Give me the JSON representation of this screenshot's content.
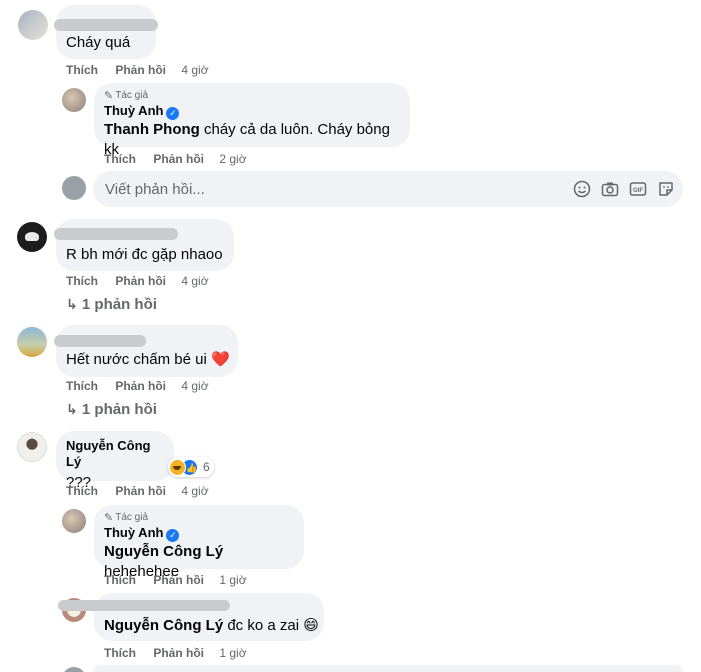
{
  "labels": {
    "like": "Thích",
    "reply": "Phản hồi",
    "author": "Tác giả"
  },
  "comments": [
    {
      "text": "Cháy quá",
      "time": "4 giờ"
    },
    {
      "text": "R bh mới đc gặp nhaoo",
      "replies_link": "1 phản hồi"
    },
    {
      "text": "Hết nước chấm bé ui ❤️",
      "time": "4 giờ",
      "replies_link": "1 phản hồi"
    },
    {
      "name": "Nguyễn Công Lý",
      "text": "???",
      "time": "4 giờ",
      "reaction_count": "6"
    },
    {
      "text": "đc ko a zai 😄",
      "mention": "Nguyễn Công Lý",
      "time": "1 giờ"
    }
  ],
  "replies": [
    {
      "name": "Thuỳ Anh",
      "mention": "Thanh Phong",
      "text": "cháy cả da luôn. Cháy bỏng kk",
      "time": "2 giờ"
    },
    {
      "name": "Thuỳ Anh",
      "mention": "Nguyễn Công Lý",
      "text": "hehehehee",
      "time": "1 giờ"
    }
  ],
  "composer": {
    "placeholder": "Viết phản hồi..."
  },
  "icons": [
    "pencil-icon",
    "verified-icon",
    "emoji-icon",
    "camera-icon",
    "gif-icon",
    "sticker-icon",
    "reply-arrow-icon"
  ],
  "colors": {
    "bubble": "#f0f2f5",
    "secondary_text": "#65676b",
    "verified": "#1877f2",
    "heart": "#e41e3f"
  }
}
